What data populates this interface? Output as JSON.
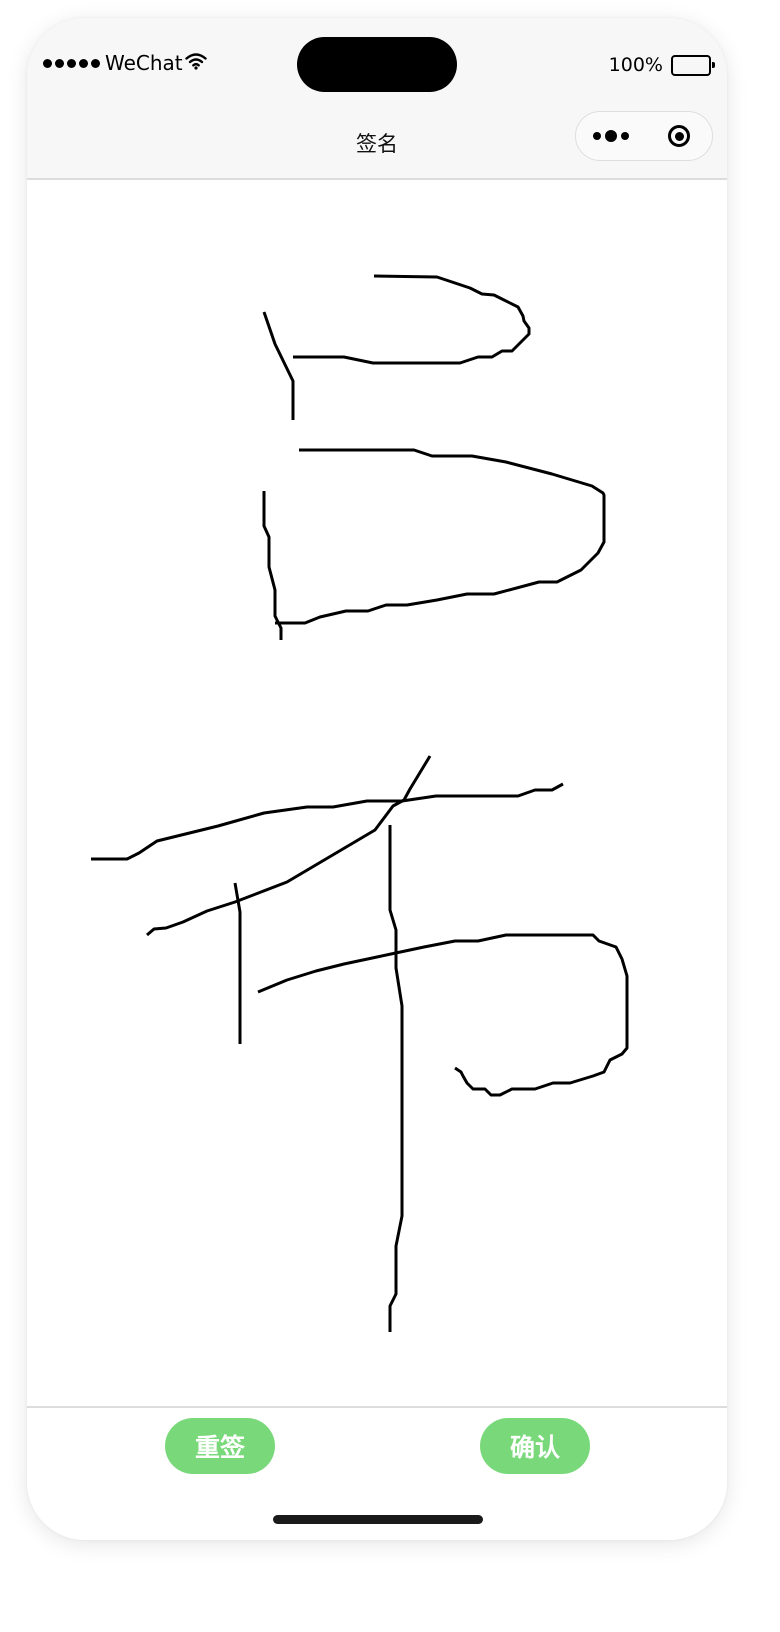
{
  "status_bar": {
    "carrier": "WeChat",
    "battery": "100%"
  },
  "nav_bar": {
    "title": "签名",
    "capsule_icons": [
      "more-dots-icon",
      "target-close-icon"
    ]
  },
  "signature": {
    "ink_color": "#000000"
  },
  "footer": {
    "reset_label": "重签",
    "confirm_label": "确认",
    "button_color": "#79d97a"
  }
}
